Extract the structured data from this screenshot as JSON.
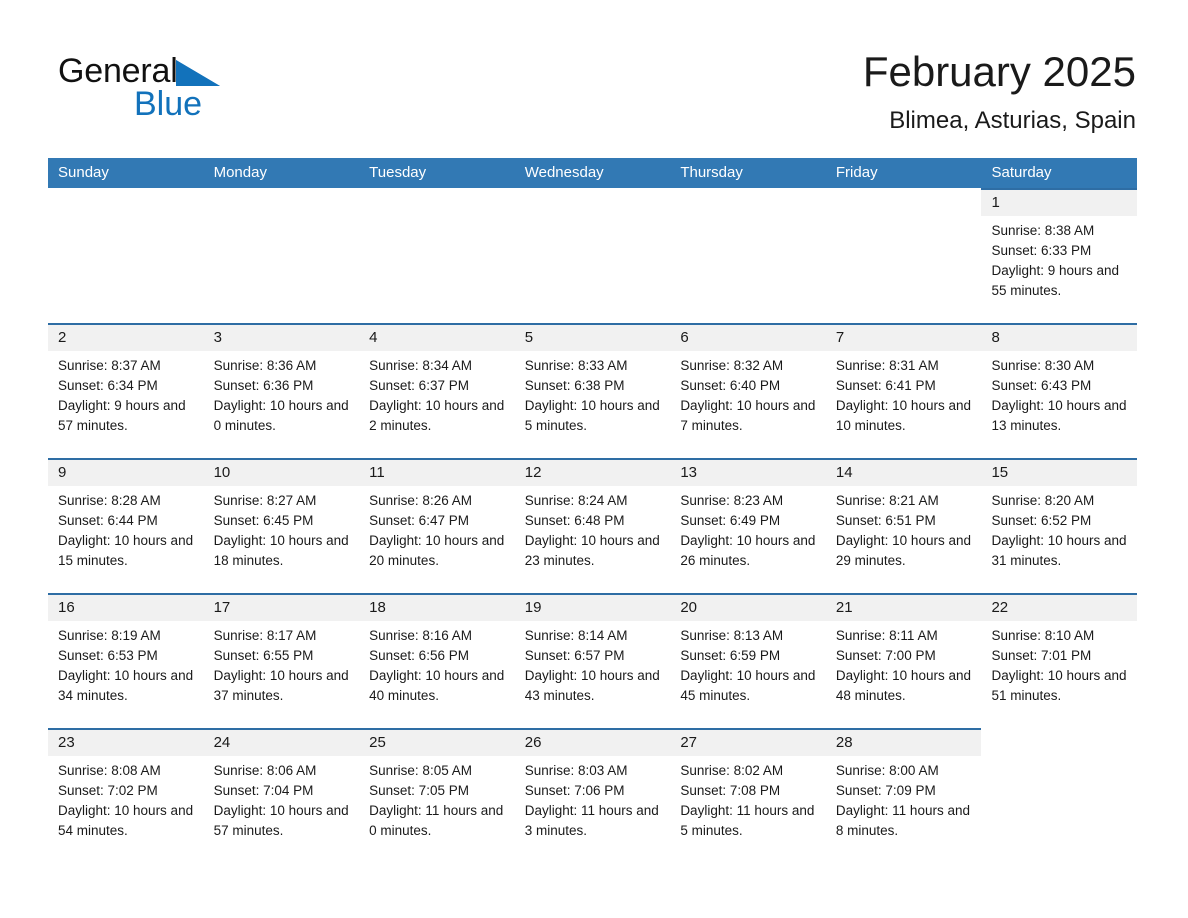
{
  "brand": {
    "name_part1": "General",
    "name_part2": "Blue",
    "triangle_color": "#1272bb"
  },
  "header": {
    "title": "February 2025",
    "subtitle": "Blimea, Asturias, Spain"
  },
  "colors": {
    "header_bar": "#3279b4",
    "row_border": "#2e6da4",
    "daynum_band": "#f1f1f1",
    "brand_blue": "#1272bb"
  },
  "weekdays": [
    "Sunday",
    "Monday",
    "Tuesday",
    "Wednesday",
    "Thursday",
    "Friday",
    "Saturday"
  ],
  "weeks": [
    [
      {
        "blank": true
      },
      {
        "blank": true
      },
      {
        "blank": true
      },
      {
        "blank": true
      },
      {
        "blank": true
      },
      {
        "blank": true
      },
      {
        "day": "1",
        "sunrise": "Sunrise: 8:38 AM",
        "sunset": "Sunset: 6:33 PM",
        "daylight": "Daylight: 9 hours and 55 minutes."
      }
    ],
    [
      {
        "day": "2",
        "sunrise": "Sunrise: 8:37 AM",
        "sunset": "Sunset: 6:34 PM",
        "daylight": "Daylight: 9 hours and 57 minutes."
      },
      {
        "day": "3",
        "sunrise": "Sunrise: 8:36 AM",
        "sunset": "Sunset: 6:36 PM",
        "daylight": "Daylight: 10 hours and 0 minutes."
      },
      {
        "day": "4",
        "sunrise": "Sunrise: 8:34 AM",
        "sunset": "Sunset: 6:37 PM",
        "daylight": "Daylight: 10 hours and 2 minutes."
      },
      {
        "day": "5",
        "sunrise": "Sunrise: 8:33 AM",
        "sunset": "Sunset: 6:38 PM",
        "daylight": "Daylight: 10 hours and 5 minutes."
      },
      {
        "day": "6",
        "sunrise": "Sunrise: 8:32 AM",
        "sunset": "Sunset: 6:40 PM",
        "daylight": "Daylight: 10 hours and 7 minutes."
      },
      {
        "day": "7",
        "sunrise": "Sunrise: 8:31 AM",
        "sunset": "Sunset: 6:41 PM",
        "daylight": "Daylight: 10 hours and 10 minutes."
      },
      {
        "day": "8",
        "sunrise": "Sunrise: 8:30 AM",
        "sunset": "Sunset: 6:43 PM",
        "daylight": "Daylight: 10 hours and 13 minutes."
      }
    ],
    [
      {
        "day": "9",
        "sunrise": "Sunrise: 8:28 AM",
        "sunset": "Sunset: 6:44 PM",
        "daylight": "Daylight: 10 hours and 15 minutes."
      },
      {
        "day": "10",
        "sunrise": "Sunrise: 8:27 AM",
        "sunset": "Sunset: 6:45 PM",
        "daylight": "Daylight: 10 hours and 18 minutes."
      },
      {
        "day": "11",
        "sunrise": "Sunrise: 8:26 AM",
        "sunset": "Sunset: 6:47 PM",
        "daylight": "Daylight: 10 hours and 20 minutes."
      },
      {
        "day": "12",
        "sunrise": "Sunrise: 8:24 AM",
        "sunset": "Sunset: 6:48 PM",
        "daylight": "Daylight: 10 hours and 23 minutes."
      },
      {
        "day": "13",
        "sunrise": "Sunrise: 8:23 AM",
        "sunset": "Sunset: 6:49 PM",
        "daylight": "Daylight: 10 hours and 26 minutes."
      },
      {
        "day": "14",
        "sunrise": "Sunrise: 8:21 AM",
        "sunset": "Sunset: 6:51 PM",
        "daylight": "Daylight: 10 hours and 29 minutes."
      },
      {
        "day": "15",
        "sunrise": "Sunrise: 8:20 AM",
        "sunset": "Sunset: 6:52 PM",
        "daylight": "Daylight: 10 hours and 31 minutes."
      }
    ],
    [
      {
        "day": "16",
        "sunrise": "Sunrise: 8:19 AM",
        "sunset": "Sunset: 6:53 PM",
        "daylight": "Daylight: 10 hours and 34 minutes."
      },
      {
        "day": "17",
        "sunrise": "Sunrise: 8:17 AM",
        "sunset": "Sunset: 6:55 PM",
        "daylight": "Daylight: 10 hours and 37 minutes."
      },
      {
        "day": "18",
        "sunrise": "Sunrise: 8:16 AM",
        "sunset": "Sunset: 6:56 PM",
        "daylight": "Daylight: 10 hours and 40 minutes."
      },
      {
        "day": "19",
        "sunrise": "Sunrise: 8:14 AM",
        "sunset": "Sunset: 6:57 PM",
        "daylight": "Daylight: 10 hours and 43 minutes."
      },
      {
        "day": "20",
        "sunrise": "Sunrise: 8:13 AM",
        "sunset": "Sunset: 6:59 PM",
        "daylight": "Daylight: 10 hours and 45 minutes."
      },
      {
        "day": "21",
        "sunrise": "Sunrise: 8:11 AM",
        "sunset": "Sunset: 7:00 PM",
        "daylight": "Daylight: 10 hours and 48 minutes."
      },
      {
        "day": "22",
        "sunrise": "Sunrise: 8:10 AM",
        "sunset": "Sunset: 7:01 PM",
        "daylight": "Daylight: 10 hours and 51 minutes."
      }
    ],
    [
      {
        "day": "23",
        "sunrise": "Sunrise: 8:08 AM",
        "sunset": "Sunset: 7:02 PM",
        "daylight": "Daylight: 10 hours and 54 minutes."
      },
      {
        "day": "24",
        "sunrise": "Sunrise: 8:06 AM",
        "sunset": "Sunset: 7:04 PM",
        "daylight": "Daylight: 10 hours and 57 minutes."
      },
      {
        "day": "25",
        "sunrise": "Sunrise: 8:05 AM",
        "sunset": "Sunset: 7:05 PM",
        "daylight": "Daylight: 11 hours and 0 minutes."
      },
      {
        "day": "26",
        "sunrise": "Sunrise: 8:03 AM",
        "sunset": "Sunset: 7:06 PM",
        "daylight": "Daylight: 11 hours and 3 minutes."
      },
      {
        "day": "27",
        "sunrise": "Sunrise: 8:02 AM",
        "sunset": "Sunset: 7:08 PM",
        "daylight": "Daylight: 11 hours and 5 minutes."
      },
      {
        "day": "28",
        "sunrise": "Sunrise: 8:00 AM",
        "sunset": "Sunset: 7:09 PM",
        "daylight": "Daylight: 11 hours and 8 minutes."
      },
      {
        "blank": true
      }
    ]
  ]
}
